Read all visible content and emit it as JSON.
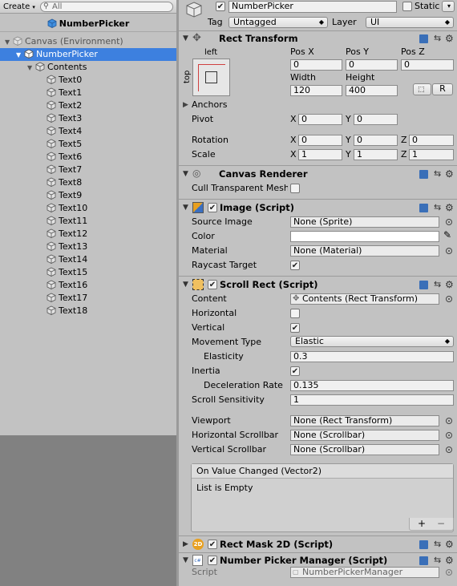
{
  "hierarchy": {
    "create_label": "Create",
    "search_placeholder": "All",
    "scene_title": "NumberPicker",
    "items": [
      {
        "label": "Canvas (Environment)",
        "depth": 0,
        "expanded": true,
        "selected": false,
        "dim": true
      },
      {
        "label": "NumberPicker",
        "depth": 1,
        "expanded": true,
        "selected": true,
        "dim": false
      },
      {
        "label": "Contents",
        "depth": 2,
        "expanded": true,
        "selected": false,
        "dim": false
      },
      {
        "label": "Text0",
        "depth": 3
      },
      {
        "label": "Text1",
        "depth": 3
      },
      {
        "label": "Text2",
        "depth": 3
      },
      {
        "label": "Text3",
        "depth": 3
      },
      {
        "label": "Text4",
        "depth": 3
      },
      {
        "label": "Text5",
        "depth": 3
      },
      {
        "label": "Text6",
        "depth": 3
      },
      {
        "label": "Text7",
        "depth": 3
      },
      {
        "label": "Text8",
        "depth": 3
      },
      {
        "label": "Text9",
        "depth": 3
      },
      {
        "label": "Text10",
        "depth": 3
      },
      {
        "label": "Text11",
        "depth": 3
      },
      {
        "label": "Text12",
        "depth": 3
      },
      {
        "label": "Text13",
        "depth": 3
      },
      {
        "label": "Text14",
        "depth": 3
      },
      {
        "label": "Text15",
        "depth": 3
      },
      {
        "label": "Text16",
        "depth": 3
      },
      {
        "label": "Text17",
        "depth": 3
      },
      {
        "label": "Text18",
        "depth": 3
      }
    ]
  },
  "header": {
    "name": "NumberPicker",
    "static_label": "Static",
    "tag_label": "Tag",
    "tag_value": "Untagged",
    "layer_label": "Layer",
    "layer_value": "UI"
  },
  "rect_transform": {
    "title": "Rect Transform",
    "anchor_h": "left",
    "anchor_v": "top",
    "pos_x_label": "Pos X",
    "pos_y_label": "Pos Y",
    "pos_z_label": "Pos Z",
    "pos_x": "0",
    "pos_y": "0",
    "pos_z": "0",
    "width_label": "Width",
    "height_label": "Height",
    "width": "120",
    "height": "400",
    "r_label": "R",
    "anchors_label": "Anchors",
    "pivot_label": "Pivot",
    "pivot_x": "0",
    "pivot_y": "0",
    "rotation_label": "Rotation",
    "rot_x": "0",
    "rot_y": "0",
    "rot_z": "0",
    "scale_label": "Scale",
    "scale_x": "1",
    "scale_y": "1",
    "scale_z": "1",
    "x": "X",
    "y": "Y",
    "z": "Z"
  },
  "canvas_renderer": {
    "title": "Canvas Renderer",
    "cull_label": "Cull Transparent Mesh"
  },
  "image": {
    "title": "Image (Script)",
    "source_label": "Source Image",
    "source_value": "None (Sprite)",
    "color_label": "Color",
    "material_label": "Material",
    "material_value": "None (Material)",
    "raycast_label": "Raycast Target"
  },
  "scroll_rect": {
    "title": "Scroll Rect (Script)",
    "content_label": "Content",
    "content_value": "Contents (Rect Transform)",
    "horizontal_label": "Horizontal",
    "vertical_label": "Vertical",
    "movement_label": "Movement Type",
    "movement_value": "Elastic",
    "elasticity_label": "Elasticity",
    "elasticity_value": "0.3",
    "inertia_label": "Inertia",
    "decel_label": "Deceleration Rate",
    "decel_value": "0.135",
    "sensitivity_label": "Scroll Sensitivity",
    "sensitivity_value": "1",
    "viewport_label": "Viewport",
    "viewport_value": "None (Rect Transform)",
    "hscroll_label": "Horizontal Scrollbar",
    "hscroll_value": "None (Scrollbar)",
    "vscroll_label": "Vertical Scrollbar",
    "vscroll_value": "None (Scrollbar)",
    "event_title": "On Value Changed (Vector2)",
    "event_body": "List is Empty",
    "plus": "+",
    "minus": "−"
  },
  "rect_mask": {
    "title": "Rect Mask 2D (Script)",
    "badge": "2D"
  },
  "number_picker": {
    "title": "Number Picker Manager (Script)",
    "badge": "c#",
    "script_label": "Script",
    "script_value": "NumberPickerManager"
  },
  "colors": {
    "selection": "#3d80df",
    "panel": "#c2c2c2",
    "dark_area": "#818181"
  }
}
